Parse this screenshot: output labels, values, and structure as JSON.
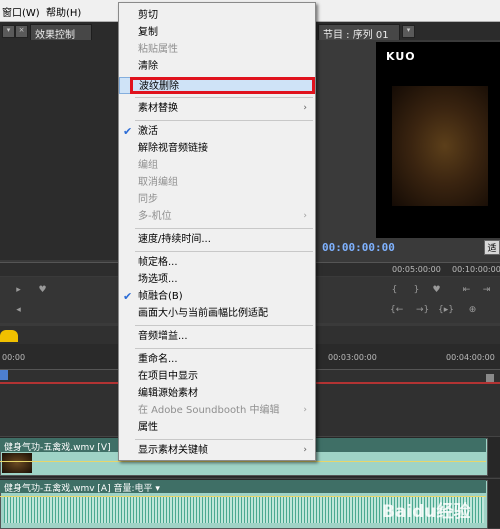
{
  "menubar": {
    "window": "窗口(W)",
    "help": "帮助(H)"
  },
  "tabs": {
    "effects": "效果控制",
    "program": "节目 : 序列 01"
  },
  "monitor": {
    "logo": "KUO",
    "timecode": "00:00:00:00",
    "button": "适"
  },
  "ruler1": [
    "00:05:00:00",
    "00:10:00:00"
  ],
  "ruler2": [
    "00:00",
    "00:03:00:00",
    "00:04:00:00"
  ],
  "tracks": {
    "video_label": "健身气功-五禽戏.wmv [V]",
    "audio_label": "健身气功-五禽戏.wmv [A]  音量:电平 ▾"
  },
  "context_menu": {
    "items": [
      {
        "label": "剪切",
        "state": "enabled"
      },
      {
        "label": "复制",
        "state": "enabled"
      },
      {
        "label": "粘贴属性",
        "state": "disabled"
      },
      {
        "label": "清除",
        "state": "enabled"
      },
      {
        "label": "波纹删除",
        "state": "highlighted"
      },
      {
        "label": "素材替换",
        "state": "submenu"
      },
      {
        "label": "激活",
        "state": "checked"
      },
      {
        "label": "解除视音频链接",
        "state": "enabled"
      },
      {
        "label": "编组",
        "state": "disabled"
      },
      {
        "label": "取消编组",
        "state": "disabled"
      },
      {
        "label": "同步",
        "state": "disabled"
      },
      {
        "label": "多-机位",
        "state": "disabled-submenu"
      },
      {
        "label": "速度/持续时间...",
        "state": "enabled"
      },
      {
        "label": "帧定格...",
        "state": "enabled"
      },
      {
        "label": "场选项...",
        "state": "enabled"
      },
      {
        "label": "帧融合(B)",
        "state": "checked"
      },
      {
        "label": "画面大小与当前画幅比例适配",
        "state": "enabled"
      },
      {
        "label": "音频增益...",
        "state": "enabled"
      },
      {
        "label": "重命名...",
        "state": "enabled"
      },
      {
        "label": "在项目中显示",
        "state": "enabled"
      },
      {
        "label": "编辑源始素材",
        "state": "enabled"
      },
      {
        "label": "在 Adobe Soundbooth 中编辑",
        "state": "disabled-submenu"
      },
      {
        "label": "属性",
        "state": "enabled"
      },
      {
        "label": "显示素材关键帧",
        "state": "submenu"
      }
    ]
  },
  "watermark": "Baidu经验",
  "colors": {
    "highlight_box": "#e0121d",
    "timecode": "#7fb2ff",
    "menu_bg": "#f0f0f0"
  }
}
